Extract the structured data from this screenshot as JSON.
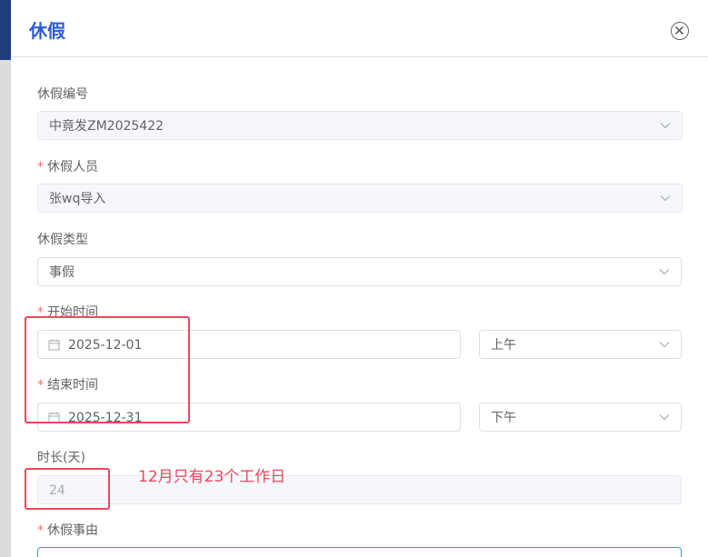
{
  "dialog": {
    "title": "休假",
    "close_icon": "close-icon"
  },
  "form": {
    "leave_no": {
      "label": "休假编号",
      "value": "中竟发ZM2025422"
    },
    "leave_person": {
      "label": "休假人员",
      "required": "*",
      "value": "张wq导入"
    },
    "leave_type": {
      "label": "休假类型",
      "value": "事假"
    },
    "start_time": {
      "label": "开始时间",
      "required": "*",
      "date": "2025-12-01",
      "period": "上午"
    },
    "end_time": {
      "label": "结束时间",
      "required": "*",
      "date": "2025-12-31",
      "period": "下午"
    },
    "duration": {
      "label": "时长(天)",
      "value": "24"
    },
    "reason": {
      "label": "休假事由",
      "required": "*",
      "value": ""
    }
  },
  "annotation": {
    "text": "12月只有23个工作日",
    "color": "#f04660"
  },
  "colors": {
    "title": "#2e5bd6",
    "required": "#f56c6c",
    "header_strip": "#1f3d7a"
  }
}
